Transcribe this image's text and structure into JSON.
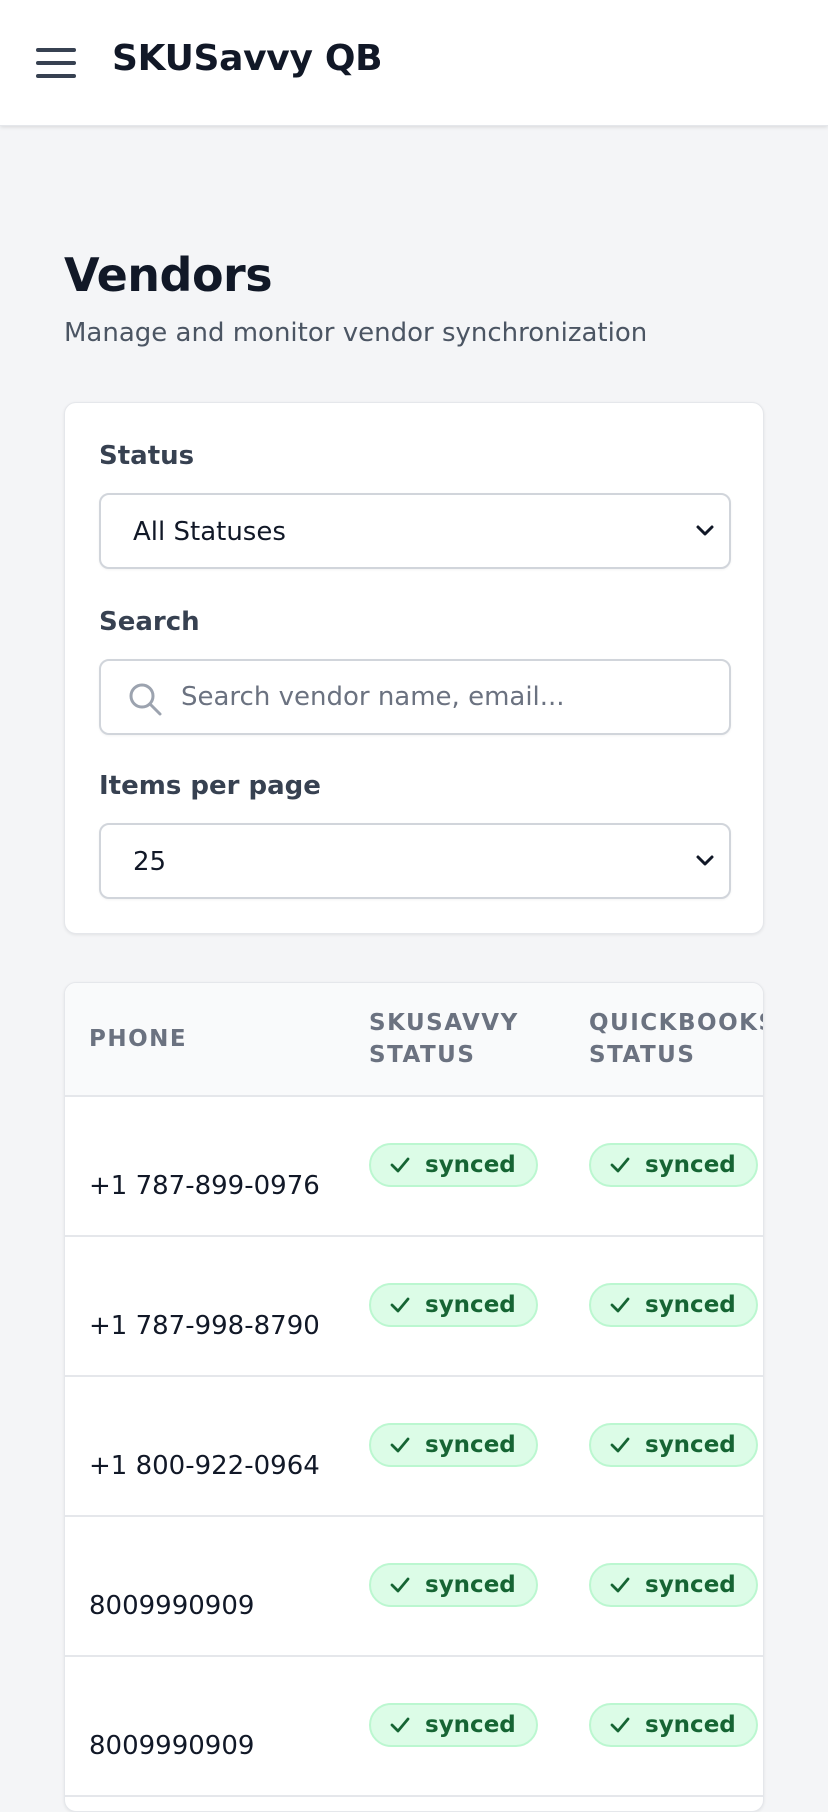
{
  "app": {
    "title": "SKUSavvy QB"
  },
  "page": {
    "title": "Vendors",
    "subtitle": "Manage and monitor vendor synchronization"
  },
  "filters": {
    "status_label": "Status",
    "status_value": "All Statuses",
    "search_label": "Search",
    "search_placeholder": "Search vendor name, email...",
    "search_value": "",
    "per_page_label": "Items per page",
    "per_page_value": "25"
  },
  "table": {
    "columns": [
      "PHONE",
      "SKUSAVVY STATUS",
      "QUICKBOOKS STATUS"
    ],
    "column_lines": [
      [
        "PHONE"
      ],
      [
        "SKUSAVVY",
        "STATUS"
      ],
      [
        "QUICKBOOKS",
        "STATUS"
      ]
    ],
    "rows": [
      {
        "phone": "+1 787-899-0976",
        "skusavvy_status": "synced",
        "quickbooks_status": "synced"
      },
      {
        "phone": "+1 787-998-8790",
        "skusavvy_status": "synced",
        "quickbooks_status": "synced"
      },
      {
        "phone": "+1 800-922-0964",
        "skusavvy_status": "synced",
        "quickbooks_status": "synced"
      },
      {
        "phone": "8009990909",
        "skusavvy_status": "synced",
        "quickbooks_status": "synced"
      },
      {
        "phone": "8009990909",
        "skusavvy_status": "synced",
        "quickbooks_status": "synced"
      }
    ]
  },
  "icons": {
    "menu": "hamburger-menu-icon",
    "search": "search-icon",
    "dropdown": "chevron-down-icon",
    "status": "check-icon"
  },
  "colors": {
    "synced_bg": "#dcfce7",
    "synced_text": "#166534"
  }
}
